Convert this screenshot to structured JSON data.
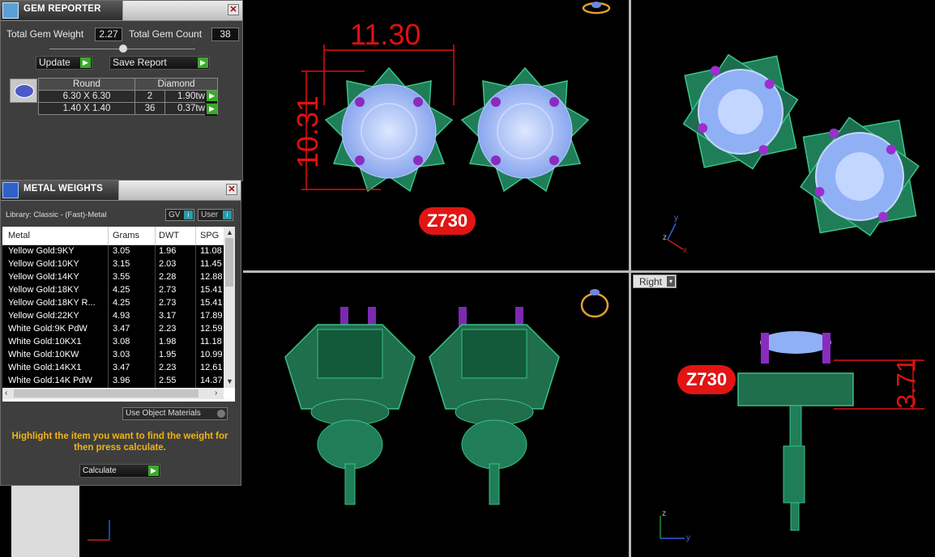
{
  "gem_reporter": {
    "title": "GEM REPORTER",
    "total_weight_label": "Total Gem Weight",
    "total_weight_value": "2.27",
    "total_count_label": "Total Gem Count",
    "total_count_value": "38",
    "update_label": "Update",
    "save_report_label": "Save Report",
    "gem_headers": [
      "Round",
      "Diamond"
    ],
    "gem_rows": [
      {
        "size": "6.30 X 6.30",
        "count": "2",
        "weight": "1.90tw"
      },
      {
        "size": "1.40 X 1.40",
        "count": "36",
        "weight": "0.37tw"
      }
    ]
  },
  "metal_weights": {
    "title": "METAL WEIGHTS",
    "library_label": "Library: Classic - (Fast)-Metal",
    "gv_label": "GV",
    "user_label": "User",
    "columns": [
      "Metal",
      "Grams",
      "DWT",
      "SPG"
    ],
    "rows": [
      [
        "Yellow Gold:9KY",
        "3.05",
        "1.96",
        "11.08"
      ],
      [
        "Yellow Gold:10KY",
        "3.15",
        "2.03",
        "11.45"
      ],
      [
        "Yellow Gold:14KY",
        "3.55",
        "2.28",
        "12.88"
      ],
      [
        "Yellow Gold:18KY",
        "4.25",
        "2.73",
        "15.41"
      ],
      [
        "Yellow Gold:18KY R...",
        "4.25",
        "2.73",
        "15.41"
      ],
      [
        "Yellow Gold:22KY",
        "4.93",
        "3.17",
        "17.89"
      ],
      [
        "White Gold:9K PdW",
        "3.47",
        "2.23",
        "12.59"
      ],
      [
        "White Gold:10KX1",
        "3.08",
        "1.98",
        "11.18"
      ],
      [
        "White Gold:10KW",
        "3.03",
        "1.95",
        "10.99"
      ],
      [
        "White Gold:14KX1",
        "3.47",
        "2.23",
        "12.61"
      ],
      [
        "White Gold:14K PdW",
        "3.96",
        "2.55",
        "14.37"
      ]
    ],
    "use_object_materials_label": "Use Object Materials",
    "instruction": "Highlight the item you want to find the weight for then press calculate.",
    "calculate_label": "Calculate"
  },
  "viewports": {
    "top_left": {
      "dim_width": "11.30",
      "dim_height": "10.31",
      "tag": "Z730"
    },
    "bottom_right": {
      "view_label": "Right",
      "dim_height": "3.71",
      "tag": "Z730"
    },
    "axis": {
      "x": "x",
      "y": "y",
      "z": "z"
    }
  },
  "colors": {
    "metal_green": "#2e9a6a",
    "gem_blue": "#a9c2ff",
    "accent_purple": "#a23ad6",
    "dimension_red": "#e01010",
    "tag_red": "#e21414"
  }
}
